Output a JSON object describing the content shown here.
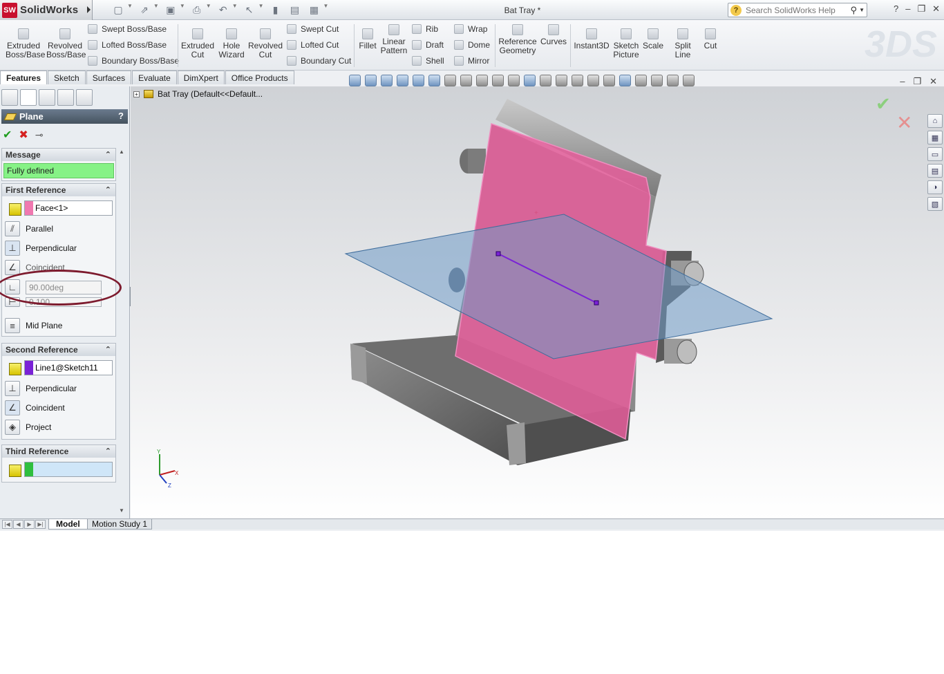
{
  "app": {
    "name": "SolidWorks",
    "document_title": "Bat Tray *"
  },
  "search": {
    "placeholder": "Search SolidWorks Help"
  },
  "window_controls": [
    "?",
    "–",
    "❐",
    "✕"
  ],
  "command_manager": {
    "extruded_boss": "Extruded\nBoss/Base",
    "revolved_boss": "Revolved\nBoss/Base",
    "swept_boss": "Swept Boss/Base",
    "lofted_boss": "Lofted Boss/Base",
    "boundary_boss": "Boundary Boss/Base",
    "extruded_cut": "Extruded\nCut",
    "hole_wizard": "Hole\nWizard",
    "revolved_cut": "Revolved\nCut",
    "swept_cut": "Swept Cut",
    "lofted_cut": "Lofted Cut",
    "boundary_cut": "Boundary Cut",
    "fillet": "Fillet",
    "linear_pattern": "Linear\nPattern",
    "rib": "Rib",
    "draft": "Draft",
    "shell": "Shell",
    "wrap": "Wrap",
    "dome": "Dome",
    "mirror": "Mirror",
    "reference_geometry": "Reference\nGeometry",
    "curves": "Curves",
    "instant3d": "Instant3D",
    "sketch_picture": "Sketch\nPicture",
    "scale": "Scale",
    "split_line": "Split Line",
    "cut": "Cut"
  },
  "tabs": [
    "Features",
    "Sketch",
    "Surfaces",
    "Evaluate",
    "DimXpert",
    "Office Products"
  ],
  "property_manager": {
    "title": "Plane",
    "help": "?",
    "message": {
      "header": "Message",
      "text": "Fully defined"
    },
    "first_reference": {
      "header": "First Reference",
      "selection": "Face<1>",
      "options": [
        "Parallel",
        "Perpendicular",
        "Coincident"
      ],
      "angle_value": "90.00deg",
      "distance_value": "0.100...",
      "mid_plane": "Mid Plane"
    },
    "second_reference": {
      "header": "Second Reference",
      "selection": "Line1@Sketch11",
      "options": [
        "Perpendicular",
        "Coincident",
        "Project"
      ]
    },
    "third_reference": {
      "header": "Third Reference",
      "selection": ""
    }
  },
  "feature_tree": {
    "root": "Bat Tray  (Default<<Default..."
  },
  "triad": {
    "x": "X",
    "y": "Y",
    "z": "Z"
  },
  "bottom_tabs": [
    "Model",
    "Motion Study 1"
  ],
  "colors": {
    "face_highlight": "#e55d9a",
    "plane_preview": "#6f9bc7",
    "sketch_line": "#7a22d6",
    "message_ok": "#86f286",
    "annotation_circle": "#7d1b2e"
  },
  "icons": {
    "ok": "checkmark-icon",
    "cancel": "x-icon",
    "pin": "pushpin-icon"
  }
}
